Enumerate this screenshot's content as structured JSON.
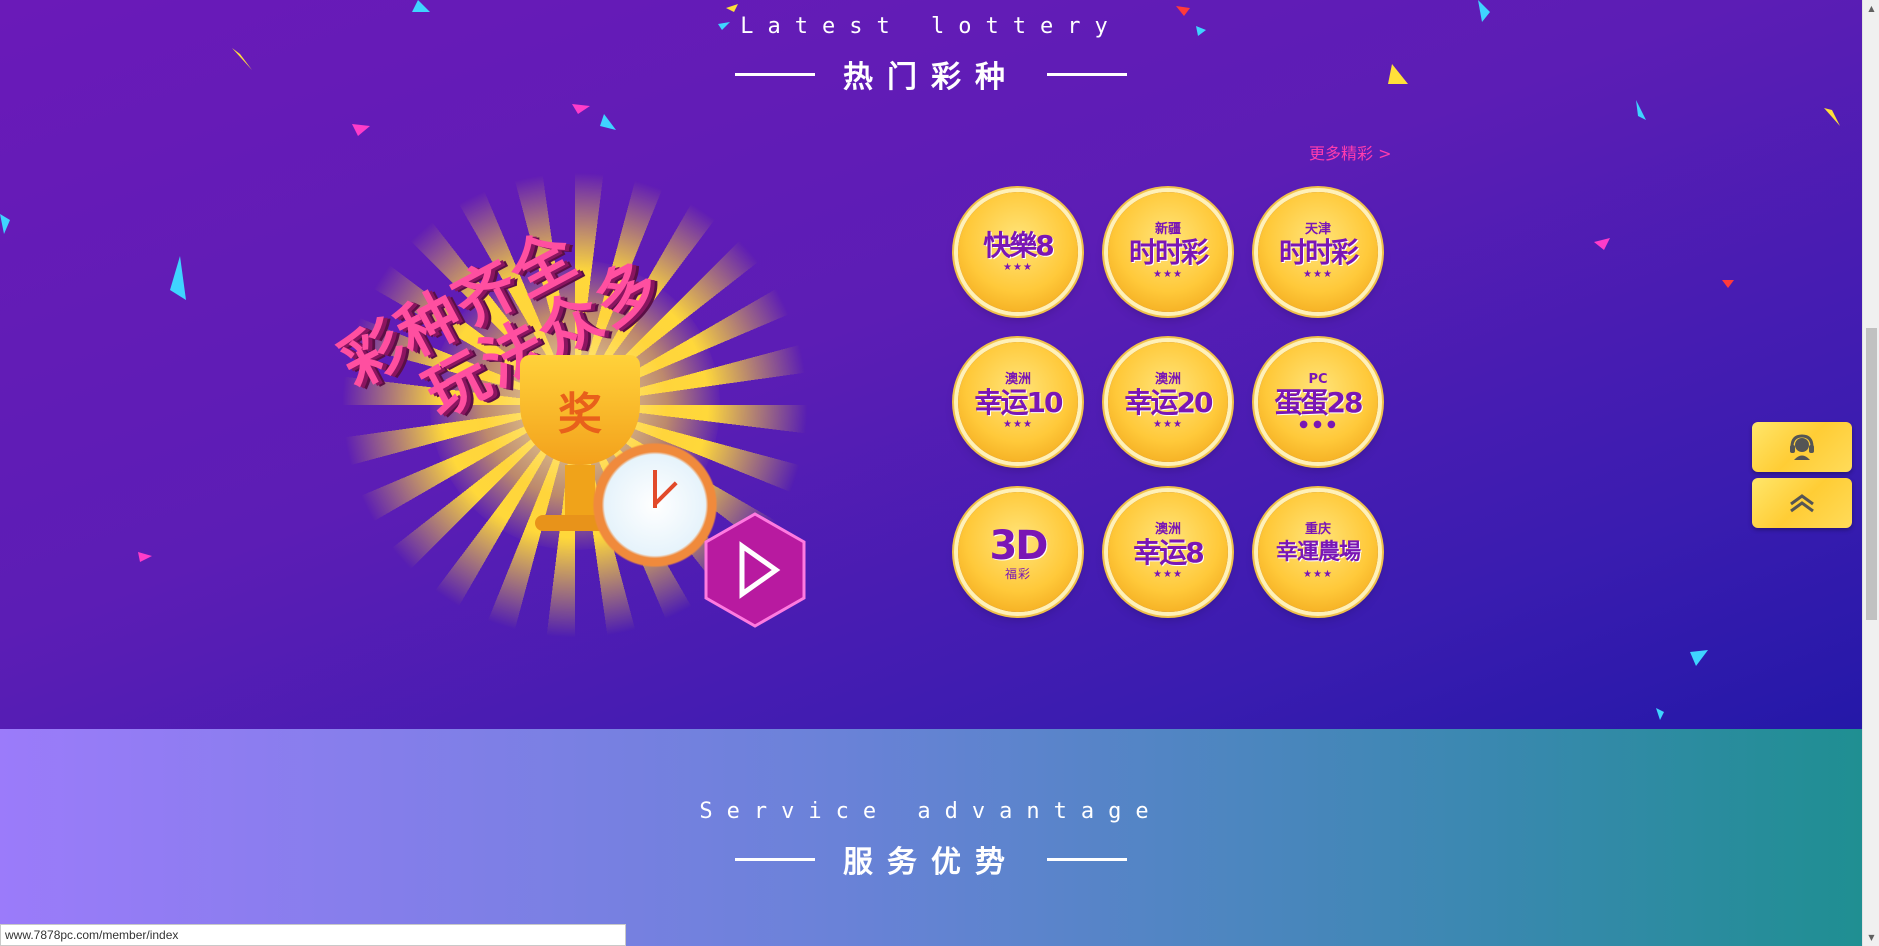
{
  "lottery_section": {
    "title_en": "Latest lottery",
    "title_cn": "热门彩种",
    "more_link": "更多精彩 >",
    "promo": {
      "slogan_line1": "彩种齐全",
      "slogan_line2": "玩法众多",
      "trophy_char": "奖"
    },
    "games": [
      {
        "sub": "",
        "main": "快樂8",
        "stars": "★★★"
      },
      {
        "sub": "新疆",
        "main": "时时彩",
        "stars": "★★★"
      },
      {
        "sub": "天津",
        "main": "时时彩",
        "stars": "★★★"
      },
      {
        "sub": "澳洲",
        "main": "幸运10",
        "stars": "★★★"
      },
      {
        "sub": "澳洲",
        "main": "幸运20",
        "stars": "★★★"
      },
      {
        "sub": "PC",
        "main": "蛋蛋28",
        "stars": "● ● ●"
      },
      {
        "sub": "",
        "main": "3D",
        "stars": "福彩"
      },
      {
        "sub": "澳洲",
        "main": "幸运8",
        "stars": "★★★"
      },
      {
        "sub": "重庆",
        "main": "幸運農場",
        "stars": "★★★"
      }
    ]
  },
  "service_section": {
    "title_en": "Service advantage",
    "title_cn": "服务优势"
  },
  "side_buttons": {
    "support_icon": "customer-service-icon",
    "top_icon": "double-chevron-up-icon"
  },
  "status_bar": {
    "url": "www.7878pc.com/member/index"
  },
  "colors": {
    "lottery_bg": "#5c1db5",
    "accent_pink": "#ff3cae",
    "coin_gold": "#ffc93a",
    "coin_text": "#7a16b5",
    "side_button": "#ffcd35"
  }
}
